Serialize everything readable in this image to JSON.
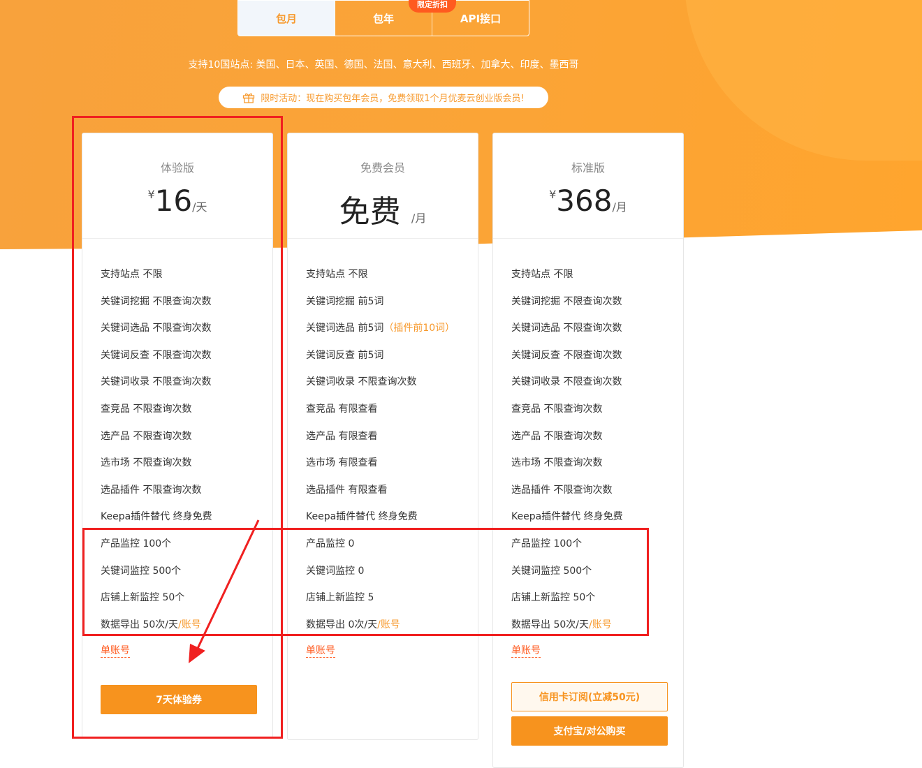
{
  "tabs": [
    {
      "label": "包月",
      "active": true
    },
    {
      "label": "包年",
      "active": false
    },
    {
      "label": "API接口",
      "active": false
    }
  ],
  "badge": "限定折扣",
  "sites_text": "支持10国站点: 美国、日本、英国、德国、法国、意大利、西班牙、加拿大、印度、墨西哥",
  "promo": {
    "icon": "gift-icon",
    "text": "限时活动：现在购买包年会员，免费领取1个月优麦云创业版会员!"
  },
  "colors": {
    "accent": "#f7931e",
    "hero": "#fba436",
    "annotation": "#f02020",
    "link": "#ff5a1f"
  },
  "plans": [
    {
      "name": "体验版",
      "currency": "¥",
      "price": "16",
      "unit": "/天",
      "features": [
        [
          "支持站点 不限",
          ""
        ],
        [
          "关键词挖掘 不限查询次数",
          ""
        ],
        [
          "关键词选品 不限查询次数",
          ""
        ],
        [
          "关键词反查 不限查询次数",
          ""
        ],
        [
          "关键词收录 不限查询次数",
          ""
        ],
        [
          "查竞品 不限查询次数",
          ""
        ],
        [
          "选产品 不限查询次数",
          ""
        ],
        [
          "选市场 不限查询次数",
          ""
        ],
        [
          "选品插件 不限查询次数",
          ""
        ],
        [
          "Keepa插件替代 终身免费",
          ""
        ],
        [
          "产品监控 100个",
          ""
        ],
        [
          "关键词监控 500个",
          ""
        ],
        [
          "店铺上新监控 50个",
          ""
        ],
        [
          "数据导出 50次/天",
          "/账号"
        ]
      ],
      "single": "单账号",
      "buttons": [
        {
          "label": "7天体验券",
          "style": "solid"
        }
      ]
    },
    {
      "name": "免费会员",
      "currency": "",
      "price": "免费",
      "unit": "/月",
      "features": [
        [
          "支持站点 不限",
          ""
        ],
        [
          "关键词挖掘 前5词",
          ""
        ],
        [
          "关键词选品 前5词",
          "（插件前10词）"
        ],
        [
          "关键词反查 前5词",
          ""
        ],
        [
          "关键词收录 不限查询次数",
          ""
        ],
        [
          "查竞品 有限查看",
          ""
        ],
        [
          "选产品 有限查看",
          ""
        ],
        [
          "选市场 有限查看",
          ""
        ],
        [
          "选品插件 有限查看",
          ""
        ],
        [
          "Keepa插件替代 终身免费",
          ""
        ],
        [
          "产品监控 0",
          ""
        ],
        [
          "关键词监控 0",
          ""
        ],
        [
          "店铺上新监控 5",
          ""
        ],
        [
          "数据导出 0次/天",
          "/账号"
        ]
      ],
      "single": "单账号",
      "buttons": []
    },
    {
      "name": "标准版",
      "currency": "¥",
      "price": "368",
      "unit": "/月",
      "features": [
        [
          "支持站点 不限",
          ""
        ],
        [
          "关键词挖掘 不限查询次数",
          ""
        ],
        [
          "关键词选品 不限查询次数",
          ""
        ],
        [
          "关键词反查 不限查询次数",
          ""
        ],
        [
          "关键词收录 不限查询次数",
          ""
        ],
        [
          "查竞品 不限查询次数",
          ""
        ],
        [
          "选产品 不限查询次数",
          ""
        ],
        [
          "选市场 不限查询次数",
          ""
        ],
        [
          "选品插件 不限查询次数",
          ""
        ],
        [
          "Keepa插件替代 终身免费",
          ""
        ],
        [
          "产品监控 100个",
          ""
        ],
        [
          "关键词监控 500个",
          ""
        ],
        [
          "店铺上新监控 50个",
          ""
        ],
        [
          "数据导出 50次/天",
          "/账号"
        ]
      ],
      "single": "单账号",
      "buttons": [
        {
          "label": "信用卡订阅(立减50元)",
          "style": "outline"
        },
        {
          "label": "支付宝/对公购买",
          "style": "solid"
        }
      ]
    }
  ]
}
